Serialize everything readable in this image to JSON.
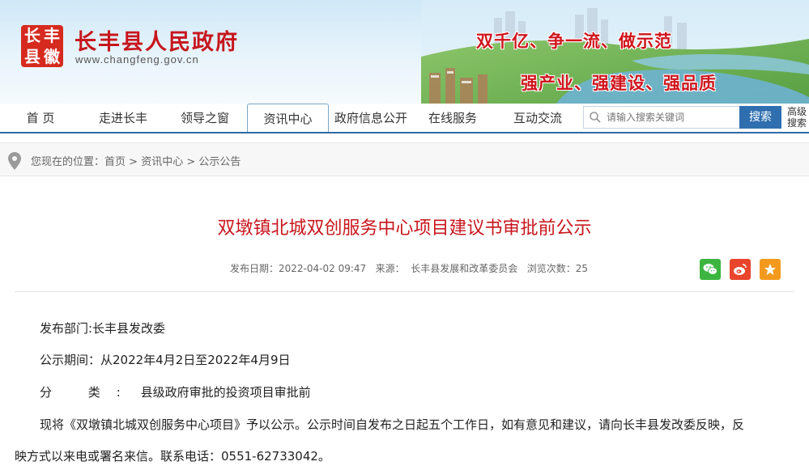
{
  "header": {
    "logo_glyphs": [
      "长",
      "丰",
      "县",
      "徽"
    ],
    "site_title": "长丰县人民政府",
    "site_url": "www.changfeng.gov.cn",
    "slogan_1": "双千亿、争一流、做示范",
    "slogan_2": "强产业、强建设、强品质"
  },
  "nav": {
    "items": [
      {
        "label": "首 页"
      },
      {
        "label": "走进长丰"
      },
      {
        "label": "领导之窗"
      },
      {
        "label": "资讯中心",
        "active": true
      },
      {
        "label": "政府信息公开"
      },
      {
        "label": "在线服务"
      },
      {
        "label": "互动交流"
      }
    ],
    "search_placeholder": "请输入搜索关键词",
    "search_button": "搜索",
    "advanced_search": "高级搜索"
  },
  "breadcrumb": {
    "prefix": "您现在的位置：",
    "items": [
      "首页",
      "资讯中心",
      "公示公告"
    ],
    "separator": " > "
  },
  "article": {
    "title": "双墩镇北城双创服务中心项目建议书审批前公示",
    "publish_label": "发布日期：",
    "publish_date": "2022-04-02 09:47",
    "source_label": "来源：",
    "source": "长丰县发展和改革委员会",
    "views_label": "浏览次数：",
    "views": "25",
    "dept_line": "发布部门:长丰县发改委",
    "period_line": "公示期间：从2022年4月2日至2022年4月9日",
    "category_label": "分 类:",
    "category_value": " 县级政府审批的投资项目审批前",
    "body_line1": "现将《双墩镇北城双创服务中心项目》予以公示。公示时间自发布之日起五个工作日，如有意见和建议，请向长丰县发改委反映，反",
    "body_line2": "映方式以来电或署名来信。联系电话：0551-62733042。"
  },
  "share": {
    "icons": [
      "wechat-icon",
      "weibo-icon",
      "star-icon"
    ]
  },
  "colors": {
    "title_red": "#c8161d",
    "nav_blue": "#2e6aa6",
    "search_blue": "#2f6fb0"
  }
}
